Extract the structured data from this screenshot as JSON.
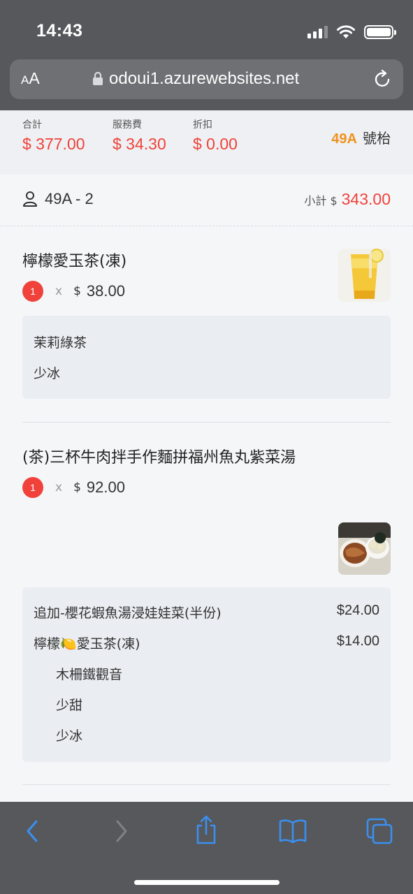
{
  "status_bar": {
    "time": "14:43"
  },
  "browser": {
    "text_size_small": "A",
    "text_size_large": "A",
    "url": "odoui1.azurewebsites.net"
  },
  "summary": {
    "total_label": "合計",
    "total_value": "$ 377.00",
    "service_label": "服務費",
    "service_value": "$ 34.30",
    "discount_label": "折扣",
    "discount_value": "$ 0.00",
    "table_code": "49A",
    "table_suffix": "號枱"
  },
  "guest": {
    "name": "49A - 2",
    "subtotal_label": "小計 $",
    "subtotal_value": "343.00"
  },
  "items": [
    {
      "name": "檸檬愛玉茶(凍)",
      "qty": "1",
      "x": "x",
      "dollar": "$",
      "price": "38.00",
      "options": [
        {
          "label": "茉莉綠茶"
        },
        {
          "label": "少冰"
        }
      ]
    },
    {
      "name": "(茶)三杯牛肉拌手作麵拼福州魚丸紫菜湯",
      "qty": "1",
      "x": "x",
      "dollar": "$",
      "price": "92.00",
      "options": [
        {
          "label": "追加-櫻花蝦魚湯浸娃娃菜(半份)",
          "price": "$24.00"
        },
        {
          "label": "檸檬",
          "emoji": "🍋",
          "label2": "愛玉茶(凍)",
          "price": "$14.00"
        },
        {
          "label": "木柵鐵觀音"
        },
        {
          "label": "少甜"
        },
        {
          "label": "少冰"
        }
      ]
    }
  ],
  "colors": {
    "accent_red": "#f0423a",
    "accent_orange": "#f0921d",
    "toolbar_blue": "#3b8ff0",
    "chrome_gray": "#56585b"
  }
}
